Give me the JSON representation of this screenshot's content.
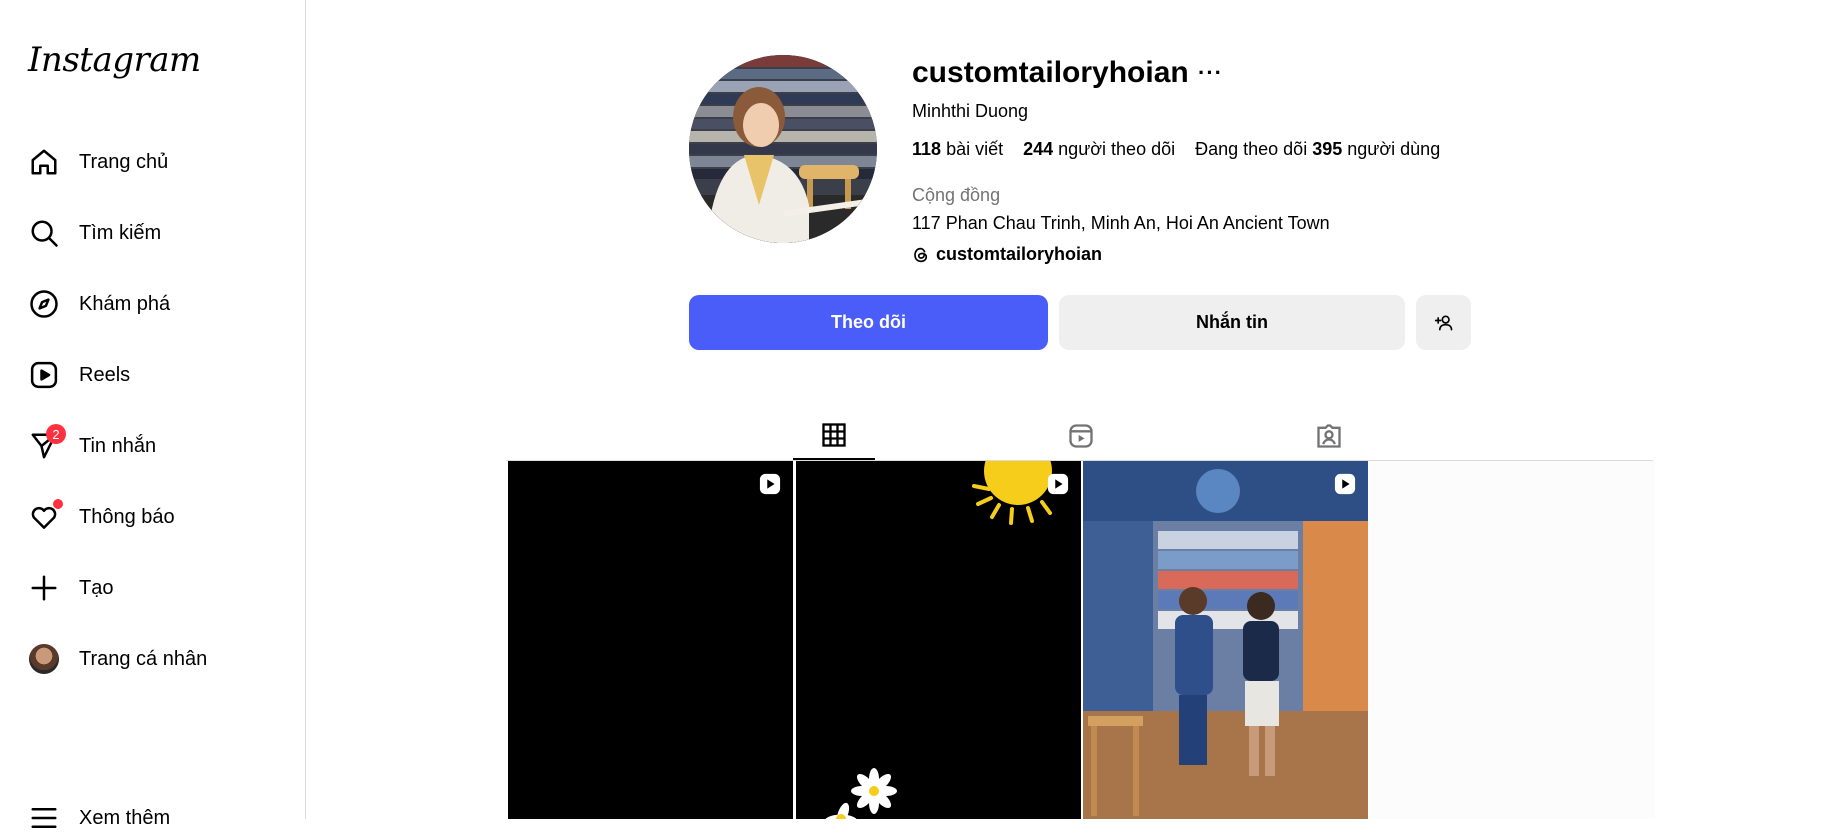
{
  "sidebar": {
    "logo": "Instagram",
    "items": [
      {
        "label": "Trang chủ",
        "icon": "home-icon"
      },
      {
        "label": "Tìm kiếm",
        "icon": "search-icon"
      },
      {
        "label": "Khám phá",
        "icon": "compass-icon"
      },
      {
        "label": "Reels",
        "icon": "reels-icon"
      },
      {
        "label": "Tin nhắn",
        "icon": "messenger-icon",
        "badge": "2"
      },
      {
        "label": "Thông báo",
        "icon": "heart-icon"
      },
      {
        "label": "Tạo",
        "icon": "plus-icon"
      },
      {
        "label": "Trang cá nhân",
        "icon": "avatar"
      }
    ],
    "more_label": "Xem thêm"
  },
  "profile": {
    "username": "customtailoryhoian",
    "more": "···",
    "full_name": "Minhthi Duong",
    "posts_count": "118",
    "posts_label": "bài viết",
    "followers_count": "244",
    "followers_label": "người theo dõi",
    "following_prefix": "Đang theo dõi",
    "following_count": "395",
    "following_label": "người dùng",
    "category": "Cộng đồng",
    "address": "117 Phan Chau Trinh, Minh An, Hoi An Ancient Town",
    "threads_handle": "customtailoryhoian"
  },
  "actions": {
    "follow": "Theo dõi",
    "message": "Nhắn tin"
  },
  "tabs": [
    {
      "name": "posts",
      "icon": "grid-icon",
      "active": true
    },
    {
      "name": "reels",
      "icon": "reels-icon",
      "active": false
    },
    {
      "name": "tagged",
      "icon": "tagged-icon",
      "active": false
    }
  ],
  "colors": {
    "accent": "#4a5df9",
    "badge": "#ff3040",
    "secondary_button": "#efefef",
    "muted_text": "#737373"
  }
}
